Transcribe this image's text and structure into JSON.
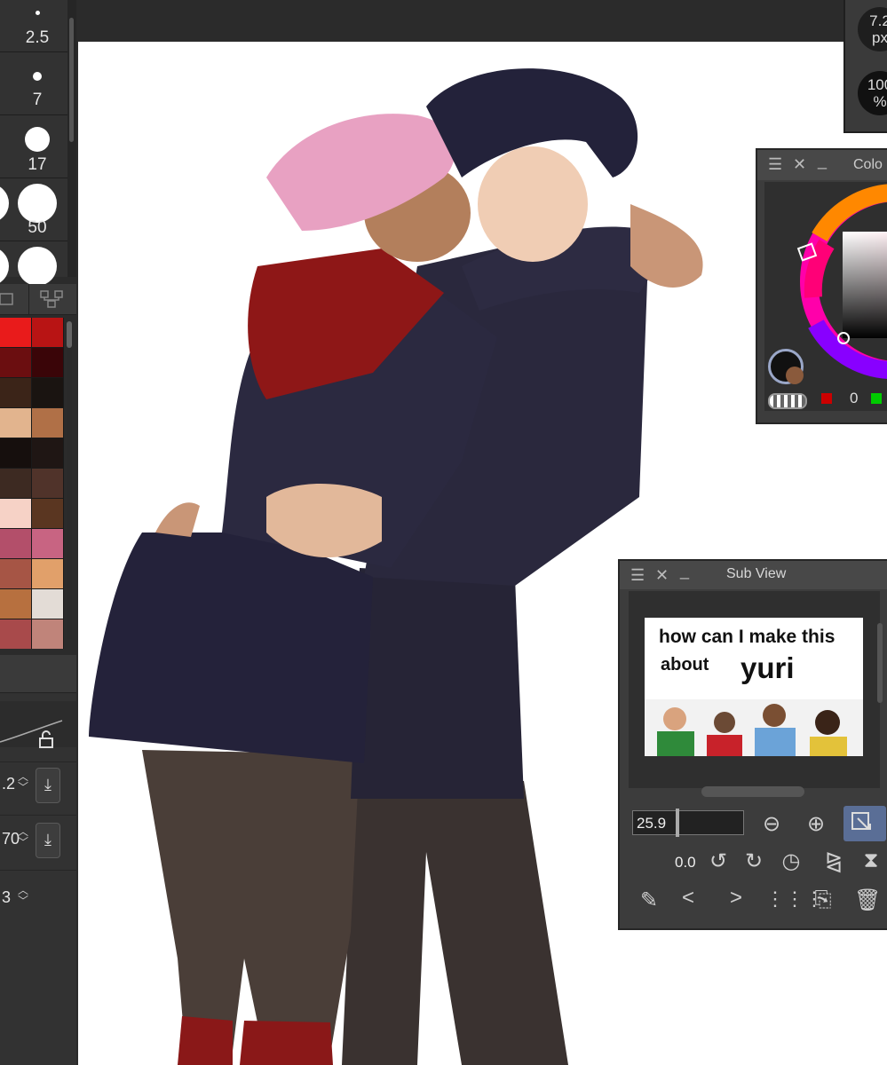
{
  "brush_sizes": [
    "2.5",
    "7",
    "17",
    "50"
  ],
  "palette": {
    "colors": [
      "#e91b1b",
      "#b81414",
      "#6b0e10",
      "#3a0508",
      "#3b2418",
      "#1a1411",
      "#e2b48e",
      "#b07047",
      "#160f0d",
      "#1f1614",
      "#3d2a22",
      "#50332a",
      "#f6d2c6",
      "#5a3621",
      "#b34f6a",
      "#c86482",
      "#a65545",
      "#e1a06a",
      "#b7703f",
      "#e3dcd6",
      "#a84a4b",
      "#c0847a"
    ]
  },
  "properties": [
    {
      "value": ".2",
      "download_icon": "download-icon"
    },
    {
      "value": "70",
      "download_icon": "download-icon"
    },
    {
      "value": "3"
    }
  ],
  "top_right_panel": {
    "size_value": "7.2",
    "size_unit": "px",
    "opacity_value": "100",
    "opacity_unit": "%"
  },
  "color_panel": {
    "title": "Colo",
    "value": "0",
    "main_color": "#111111",
    "sub_color": "#8a5a3c"
  },
  "sub_view": {
    "title": "Sub View",
    "reference_image": {
      "line1": "how can I make this",
      "line2": "about",
      "line3": "yuri"
    },
    "zoom": "25.9",
    "angle": "0.0"
  }
}
